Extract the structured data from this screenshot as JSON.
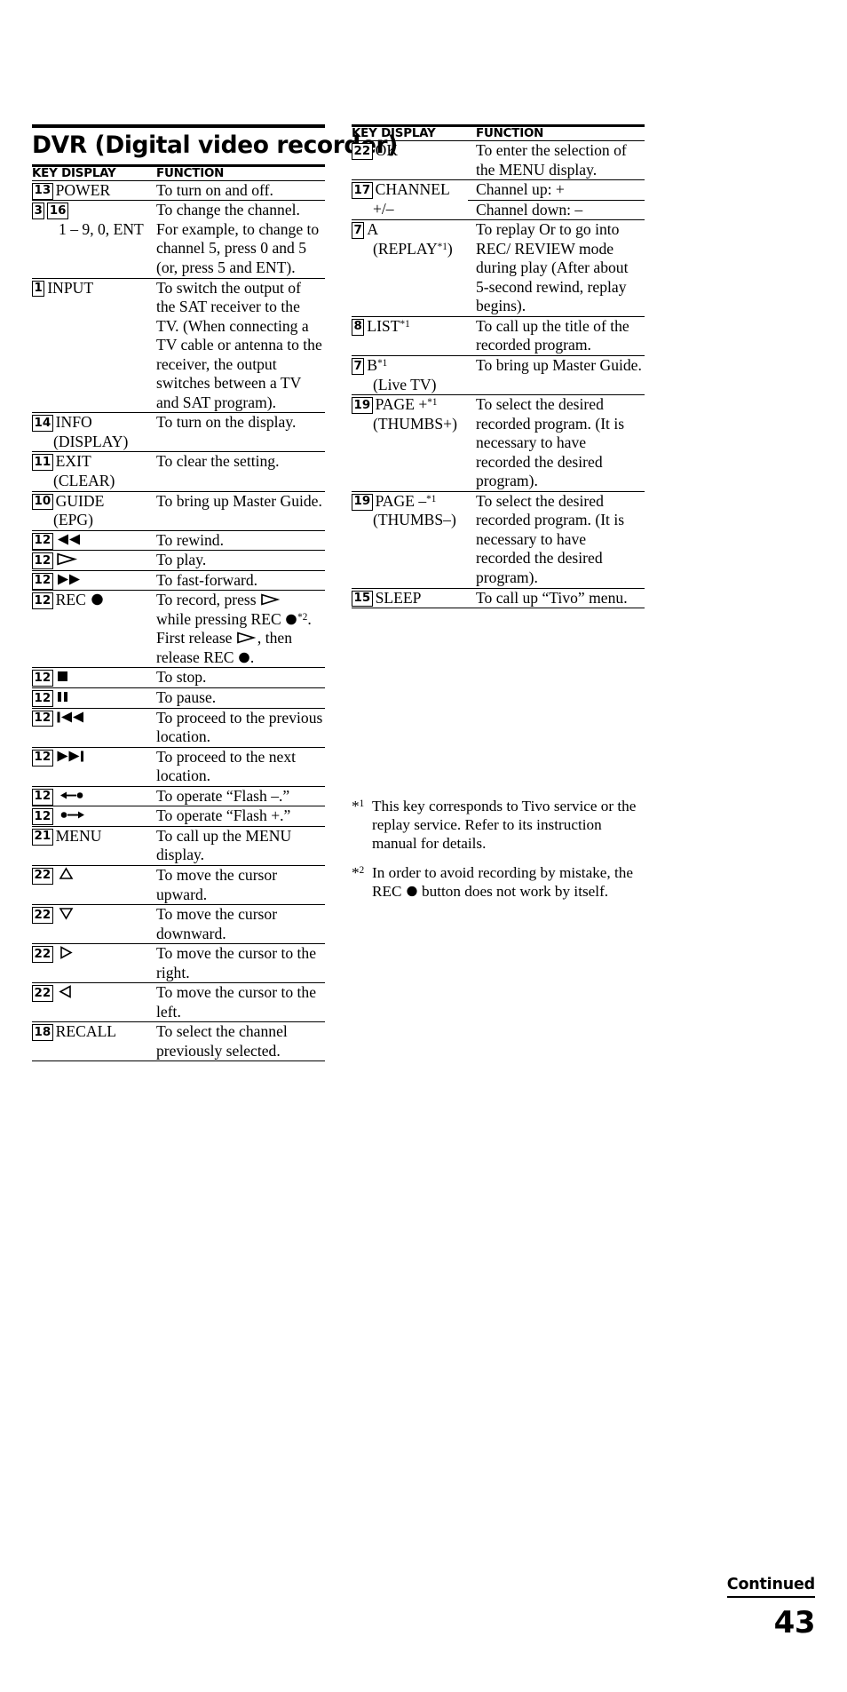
{
  "page": {
    "title": "DVR (Digital video recorder)",
    "number": "43",
    "continued_label": "Continued"
  },
  "table_headers": {
    "key": "KEY DISPLAY",
    "function": "FUNCTION"
  },
  "left_column": {
    "rows": [
      {
        "keybox": "13",
        "key_label": "POWER",
        "function": "To turn on and off."
      },
      {
        "keybox": "3",
        "keybox2": "16",
        "key_label": "",
        "key_sub": "1 – 9, 0, ENT",
        "function": "To change the channel. For example, to change to channel 5, press 0 and 5 (or, press 5 and ENT)."
      },
      {
        "keybox": "1",
        "key_label": "INPUT",
        "function": "To switch the output of the SAT receiver to the TV. (When connecting a TV cable or antenna to the receiver, the output switches between a TV and SAT program)."
      },
      {
        "keybox": "14",
        "key_label": "INFO",
        "key_sub": "(DISPLAY)",
        "function": "To turn on the display."
      },
      {
        "keybox": "11",
        "key_label": "EXIT",
        "key_sub": "(CLEAR)",
        "function": "To clear the setting."
      },
      {
        "keybox": "10",
        "key_label": "GUIDE",
        "key_sub": "(EPG)",
        "function": "To bring up Master Guide."
      },
      {
        "keybox": "12",
        "key_icon": "rewind-icon",
        "function": "To rewind."
      },
      {
        "keybox": "12",
        "key_icon": "play-icon",
        "function": "To play."
      },
      {
        "keybox": "12",
        "key_icon": "fast-forward-icon",
        "function": "To fast-forward."
      },
      {
        "keybox": "12",
        "key_label": "REC",
        "key_icon": "record-icon",
        "function_rich": "rec-instructions"
      },
      {
        "keybox": "12",
        "key_icon": "stop-icon",
        "function": "To stop."
      },
      {
        "keybox": "12",
        "key_icon": "pause-icon",
        "function": "To pause."
      },
      {
        "keybox": "12",
        "key_icon": "previous-icon",
        "function": "To proceed to the previous location."
      },
      {
        "keybox": "12",
        "key_icon": "next-icon",
        "function": "To proceed to the next location."
      },
      {
        "keybox": "12",
        "key_icon": "flash-back-icon",
        "function": "To operate “Flash –.”"
      },
      {
        "keybox": "12",
        "key_icon": "flash-forward-icon",
        "function": "To operate “Flash +.”"
      },
      {
        "keybox": "21",
        "key_label": "MENU",
        "function": "To call up the MENU display."
      },
      {
        "keybox": "22",
        "key_icon": "cursor-up-icon",
        "function": "To move the cursor upward."
      },
      {
        "keybox": "22",
        "key_icon": "cursor-down-icon",
        "function": "To move the cursor downward."
      },
      {
        "keybox": "22",
        "key_icon": "cursor-right-icon",
        "function": "To move the cursor to the right."
      },
      {
        "keybox": "22",
        "key_icon": "cursor-left-icon",
        "function": "To move the cursor to the left."
      },
      {
        "keybox": "18",
        "key_label": "RECALL",
        "function": "To select the channel previously selected."
      }
    ]
  },
  "right_column": {
    "rows": [
      {
        "keybox": "22",
        "key_label": "OK",
        "function": "To enter the selection of the MENU display."
      },
      {
        "keybox": "17",
        "key_label": "CHANNEL",
        "key_sub": "+/–",
        "function": "Channel up: +",
        "function2": "Channel down: –",
        "split": true
      },
      {
        "keybox": "7",
        "key_label": "A",
        "key_sub": "(REPLAY*1)",
        "key_sub_sup": "1",
        "function": "To replay Or to go into REC/ REVIEW mode during play (After about 5-second rewind, replay begins)."
      },
      {
        "keybox": "8",
        "key_label": "LIST",
        "key_label_sup": "1",
        "function": "To call up the title of the recorded program."
      },
      {
        "keybox": "7",
        "key_label": "B",
        "key_label_sup": "1",
        "key_sub": "(Live TV)",
        "function": "To bring up Master Guide."
      },
      {
        "keybox": "19",
        "key_label": "PAGE +",
        "key_label_sup": "1",
        "key_sub": "(THUMBS+)",
        "function": "To select the desired recorded program. (It is necessary to have recorded the desired program)."
      },
      {
        "keybox": "19",
        "key_label": "PAGE –",
        "key_label_sup": "1",
        "key_sub": "(THUMBS–)",
        "function": "To select the desired recorded program. (It is necessary to have recorded the desired program)."
      },
      {
        "keybox": "15",
        "key_label": "SLEEP",
        "function": "To call up “Tivo” menu."
      }
    ]
  },
  "footnotes": [
    {
      "mark_sup": "1",
      "text": "This key corresponds to Tivo service or the replay service. Refer to its instruction manual for details."
    },
    {
      "mark_sup": "2",
      "text_before": "In order to avoid recording by mistake, the REC ",
      "icon": "record-icon",
      "text_after": " button does not work by itself."
    }
  ],
  "rec_instructions": {
    "line1_a": "To record, press ",
    "line1_icon": "play-icon",
    "line2_a": "while pressing REC ",
    "line2_icon": "record-icon",
    "line2_sup": "2",
    "line2_b": ".",
    "line3_a": "First release ",
    "line3_icon": "play-icon",
    "line3_b": ", then",
    "line4_a": "release REC ",
    "line4_icon": "record-icon",
    "line4_b": "."
  }
}
